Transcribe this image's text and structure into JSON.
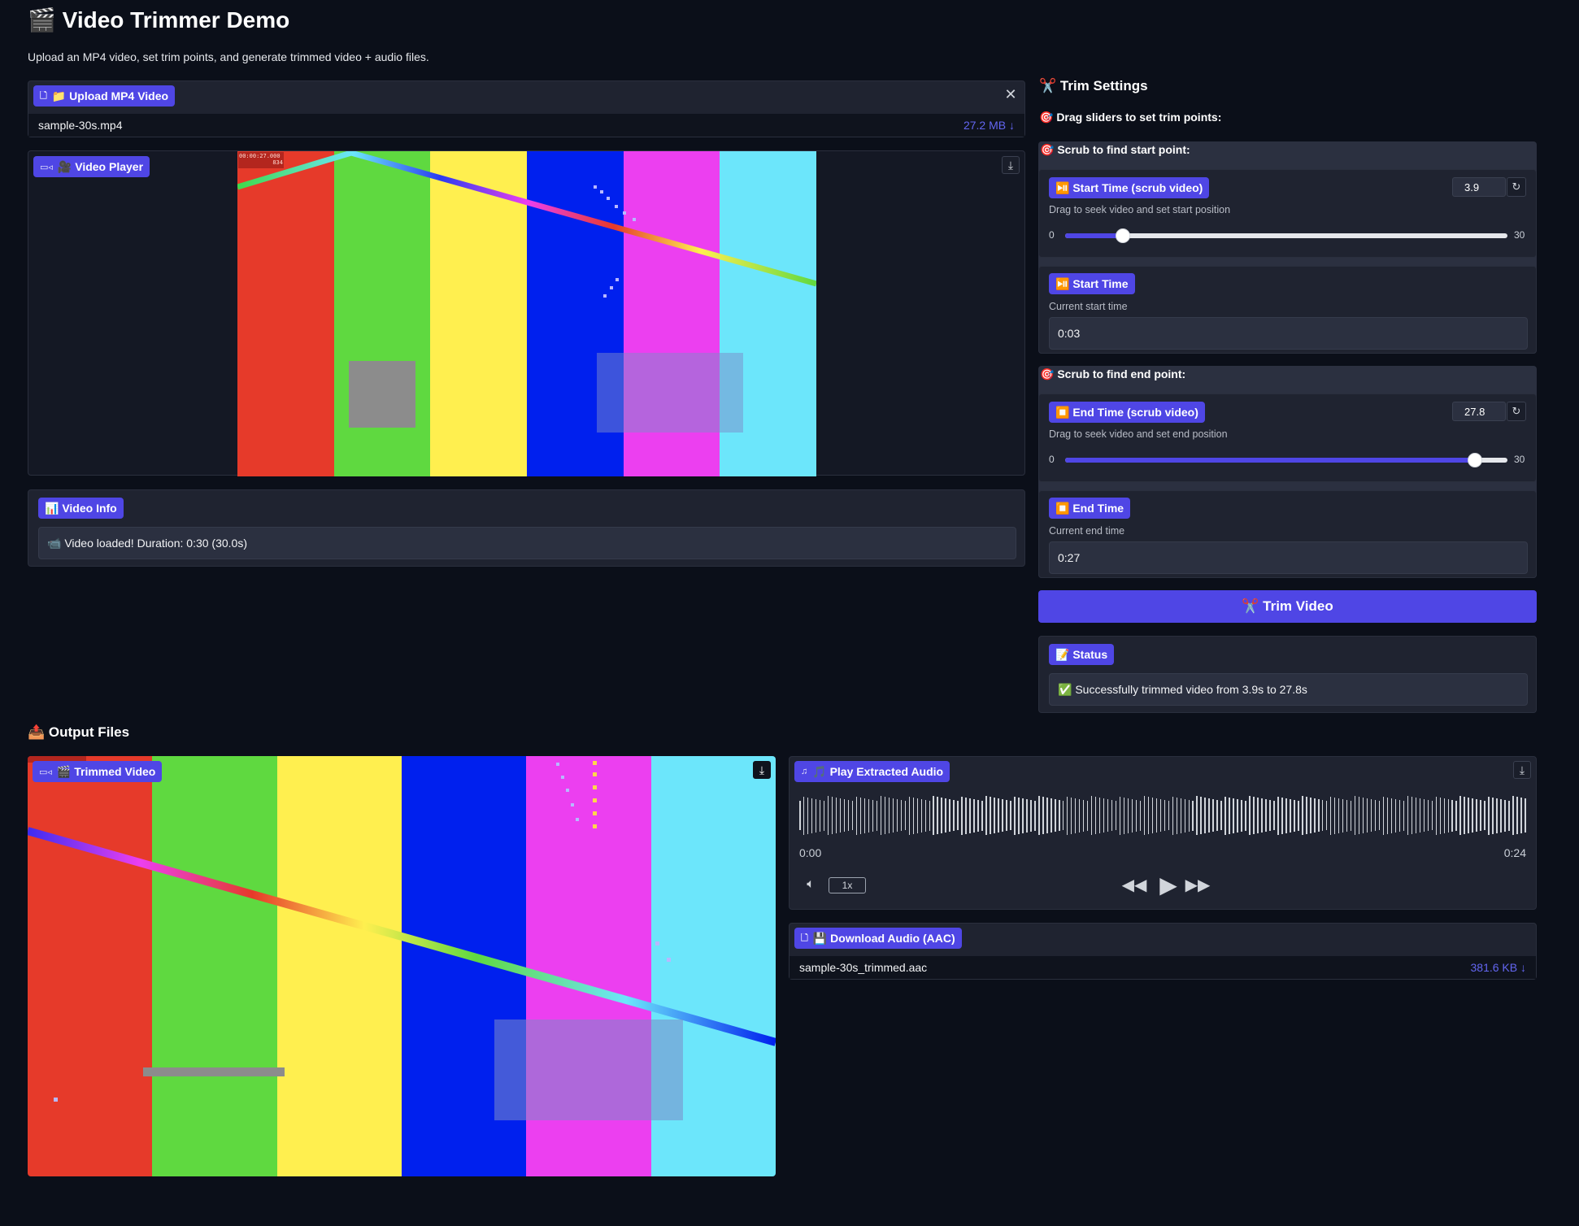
{
  "header": {
    "icon": "🎬",
    "title": "Video Trimmer Demo",
    "subtitle": "Upload an MP4 video, set trim points, and generate trimmed video + audio files."
  },
  "upload": {
    "label": "📁 Upload MP4 Video",
    "file_name": "sample-30s.mp4",
    "file_size": "27.2 MB ↓",
    "clear_icon": "close-icon"
  },
  "player": {
    "label": "🎥 Video Player",
    "timestamp": "00:00:27.000",
    "frame": "834"
  },
  "video_info": {
    "label": "📊 Video Info",
    "text": "📹 Video loaded! Duration: 0:30 (30.0s)"
  },
  "trim": {
    "title": "✂️ Trim Settings",
    "instruction": "🎯 Drag sliders to set trim points:",
    "start_section": "🎯 Scrub to find start point:",
    "start_slider": {
      "label": "⏯️ Start Time (scrub video)",
      "help": "Drag to seek video and set start position",
      "value": "3.9",
      "min": "0",
      "max": "30",
      "position_fraction": 0.13
    },
    "start_time": {
      "label": "⏯️ Start Time",
      "help": "Current start time",
      "value": "0:03"
    },
    "end_section": "🎯 Scrub to find end point:",
    "end_slider": {
      "label": "⏹️ End Time (scrub video)",
      "help": "Drag to seek video and set end position",
      "value": "27.8",
      "min": "0",
      "max": "30",
      "position_fraction": 0.927
    },
    "end_time": {
      "label": "⏹️ End Time",
      "help": "Current end time",
      "value": "0:27"
    },
    "button": "✂️ Trim Video"
  },
  "status": {
    "label": "📝 Status",
    "text": "✅ Successfully trimmed video from 3.9s to 27.8s"
  },
  "output": {
    "title": "📤 Output Files",
    "trimmed_label": "🎬 Trimmed Video",
    "audio_label": "🎵 Play Extracted Audio",
    "audio_current": "0:00",
    "audio_duration": "0:24",
    "speed": "1x",
    "download_label": "💾 Download Audio (AAC)",
    "download_file": "sample-30s_trimmed.aac",
    "download_size": "381.6 KB ↓"
  },
  "colors": {
    "accent": "#4f46e5",
    "background": "#0b0f19",
    "panel": "#1f2330"
  }
}
